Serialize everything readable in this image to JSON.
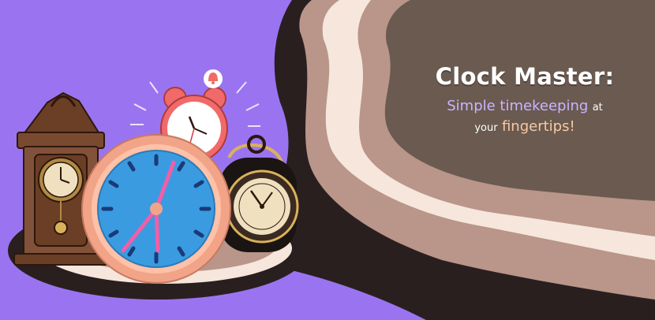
{
  "banner": {
    "title": "Clock Master:",
    "line2_highlight": "Simple timekeeping",
    "line2_rest": "at",
    "line3_lead": "your",
    "line3_highlight": "fingertips!"
  },
  "colors": {
    "background": "#9a74f0",
    "panel": "#6a5a50",
    "wave_tan": "#b9958a",
    "wave_cream": "#f6e6dc",
    "wave_dark": "#2a1f1f",
    "highlight_lavender": "#c8b4ff",
    "highlight_peach": "#f7c9a4"
  },
  "icons": [
    "grandfather-clock-icon",
    "alarm-clock-icon",
    "bell-icon",
    "wall-clock-icon",
    "pocket-watch-icon"
  ]
}
